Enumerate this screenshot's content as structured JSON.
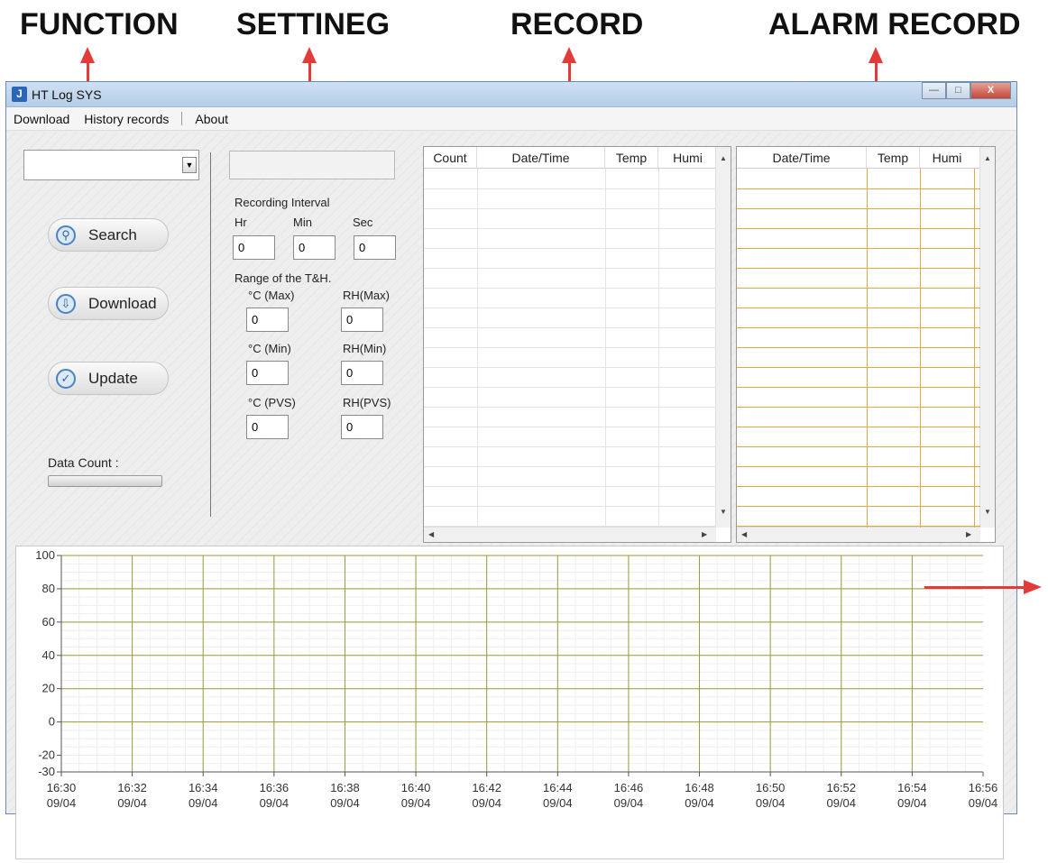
{
  "annotations": {
    "function": "FUNCTION",
    "setting": "SETTINEG",
    "record": "RECORD",
    "alarm_record": "ALARM RECORD"
  },
  "window": {
    "title": "HT Log SYS",
    "icon_letter": "J",
    "controls": [
      "minimize",
      "maximize",
      "close"
    ],
    "close_glyph": "X"
  },
  "menu": [
    "Download",
    "History records",
    "About"
  ],
  "function_panel": {
    "buttons": [
      {
        "label": "Search",
        "icon": "search-icon"
      },
      {
        "label": "Download",
        "icon": "download-icon"
      },
      {
        "label": "Update",
        "icon": "check-icon"
      }
    ],
    "data_count_label": "Data Count :"
  },
  "settings": {
    "recording_interval_label": "Recording Interval",
    "hr_label": "Hr",
    "min_label": "Min",
    "sec_label": "Sec",
    "hr": "0",
    "min": "0",
    "sec": "0",
    "range_label": "Range of the T&H.",
    "c_max_label": "°C (Max)",
    "rh_max_label": "RH(Max)",
    "c_min_label": "°C (Min)",
    "rh_min_label": "RH(Min)",
    "c_pvs_label": "°C (PVS)",
    "rh_pvs_label": "RH(PVS)",
    "c_max": "0",
    "rh_max": "0",
    "c_min": "0",
    "rh_min": "0",
    "c_pvs": "0",
    "rh_pvs": "0"
  },
  "record_table": {
    "columns": [
      "Count",
      "Date/Time",
      "Temp",
      "Humi"
    ],
    "rows": []
  },
  "alarm_table": {
    "columns": [
      "Date/Time",
      "Temp",
      "Humi"
    ],
    "rows": [],
    "line_color": "#e8a53c"
  },
  "chart_data": {
    "type": "line",
    "series": [],
    "y_ticks": [
      100,
      80,
      60,
      40,
      20,
      0,
      -20,
      -30
    ],
    "ylim": [
      -30,
      100
    ],
    "x_ticks": [
      {
        "time": "16:30",
        "date": "09/04"
      },
      {
        "time": "16:32",
        "date": "09/04"
      },
      {
        "time": "16:34",
        "date": "09/04"
      },
      {
        "time": "16:36",
        "date": "09/04"
      },
      {
        "time": "16:38",
        "date": "09/04"
      },
      {
        "time": "16:40",
        "date": "09/04"
      },
      {
        "time": "16:42",
        "date": "09/04"
      },
      {
        "time": "16:44",
        "date": "09/04"
      },
      {
        "time": "16:46",
        "date": "09/04"
      },
      {
        "time": "16:48",
        "date": "09/04"
      },
      {
        "time": "16:50",
        "date": "09/04"
      },
      {
        "time": "16:52",
        "date": "09/04"
      },
      {
        "time": "16:54",
        "date": "09/04"
      },
      {
        "time": "16:56",
        "date": "09/04"
      }
    ],
    "grid": true,
    "grid_color": "#9a9a3a"
  }
}
